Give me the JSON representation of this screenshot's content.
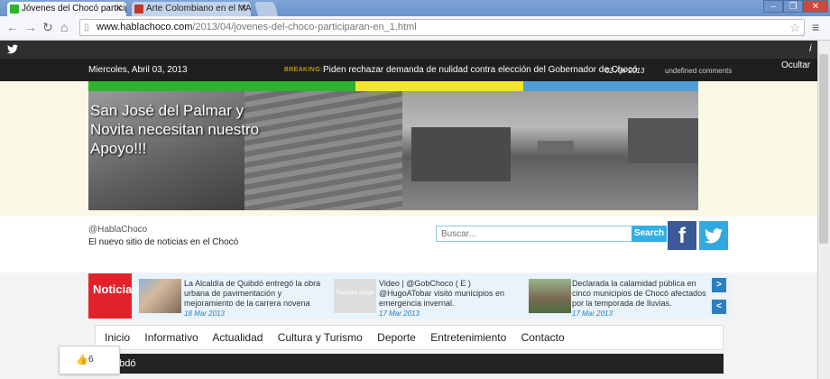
{
  "browser": {
    "tabs": [
      {
        "title": "Jóvenes del Chocó participar"
      },
      {
        "title": "Arte Colombiano en el MAC |"
      }
    ],
    "url_host": "www.hablachoco.com",
    "url_path": "/2013/04/jovenes-del-choco-participaran-en_1.html"
  },
  "topbar": {
    "info_icon": "i"
  },
  "datebar": {
    "date": "Miercoles, Abril 03, 2013",
    "breaking_label": "BREAKING:",
    "headline": "Piden rechazar demanda de nulidad contra elección del Gobernador de Chocó",
    "headline_date": "02 Apr 2013",
    "comments": "undefined comments",
    "hide": "Ocultar"
  },
  "colors": {
    "green": "#2db32d",
    "yellow": "#f1e62b",
    "blue": "#4e9fd5",
    "red": "#e3212b",
    "dark": "#1f1f1f"
  },
  "banner": {
    "text": "San José del Palmar y Novita necesitan nuestro Apoyo!!!"
  },
  "site": {
    "handle": "@HablaChoco",
    "tagline": "El nuevo sitio de noticias en el Chocó"
  },
  "search": {
    "placeholder": "Buscar...",
    "button": "Search"
  },
  "ticker": {
    "label": "Noticias",
    "items": [
      {
        "text": "La Alcaldía de Quibdó entregó la obra urbana de pavimentación y mejoramiento de la carrera novena",
        "date": "18 Mar 2013"
      },
      {
        "text": "Video | @GobChoco ( E ) @HugoATobar visitó municipios en emergencia invernal.",
        "date": "17 Mar 2013",
        "thumb_label": "Featured Image"
      },
      {
        "text": "Declarada la calamidad pública en cinco municipios de Chocó afectados por la temporada de lluvias.",
        "date": "17 Mar 2013"
      }
    ],
    "next": ">",
    "prev": "<"
  },
  "menu": [
    "Inicio",
    "Informativo",
    "Actualidad",
    "Cultura y Turismo",
    "Deporte",
    "Entretenimiento",
    "Contacto"
  ],
  "section": {
    "title": "Quibdó"
  },
  "like": {
    "count": "6"
  }
}
